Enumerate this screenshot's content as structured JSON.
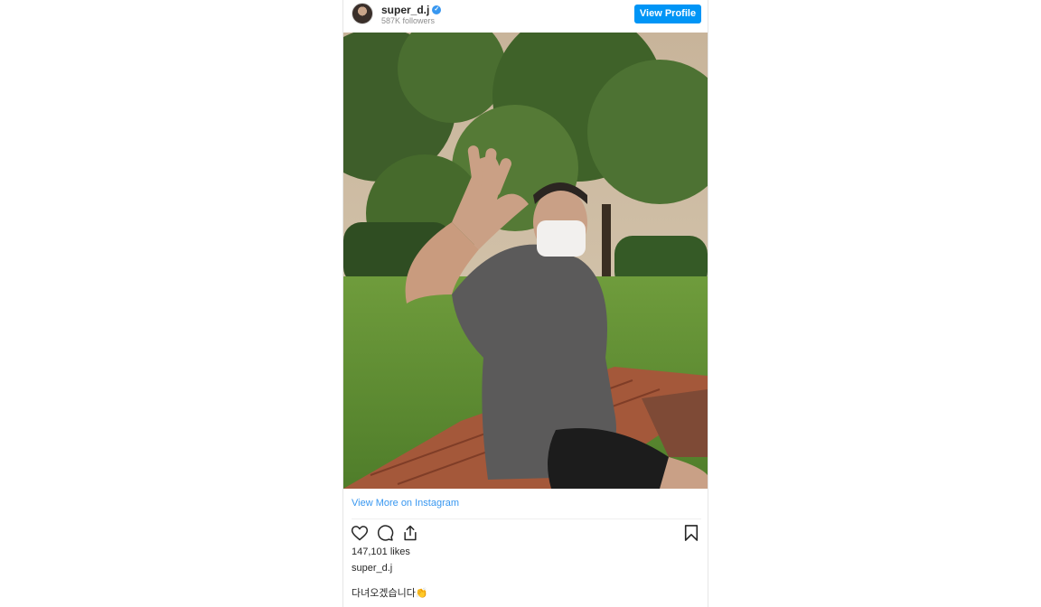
{
  "profile": {
    "username": "super_d.j",
    "followers": "587K followers",
    "view_profile_label": "View Profile"
  },
  "post": {
    "view_more_label": "View More on Instagram",
    "likes": "147,101 likes",
    "author": "super_d.j",
    "caption": "다녀오겠습니다👏"
  },
  "icons": {
    "verified": "verified-badge-icon",
    "like": "heart-icon",
    "comment": "comment-bubble-icon",
    "share": "share-icon",
    "save": "bookmark-icon"
  },
  "colors": {
    "accent": "#0095f6",
    "link": "#3897f0",
    "text": "#262626",
    "muted": "#8e8e8e"
  }
}
